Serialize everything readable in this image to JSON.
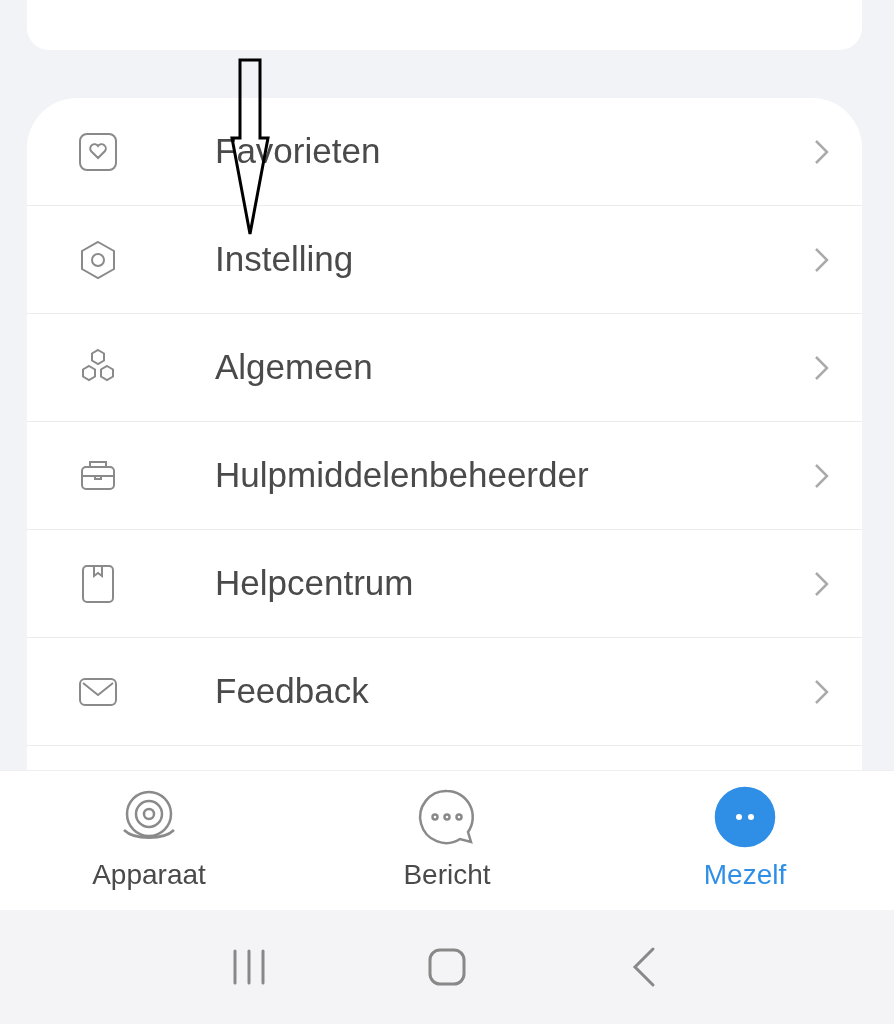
{
  "menu": [
    {
      "label": "Favorieten",
      "kind": "heart"
    },
    {
      "label": "Instelling",
      "kind": "hexagon"
    },
    {
      "label": "Algemeen",
      "kind": "cluster"
    },
    {
      "label": "Hulpmiddelenbeheerder",
      "kind": "toolbox"
    },
    {
      "label": "Helpcentrum",
      "kind": "book"
    },
    {
      "label": "Feedback",
      "kind": "mail"
    }
  ],
  "tabs": [
    {
      "label": "Apparaat",
      "kind": "device",
      "selected": false
    },
    {
      "label": "Bericht",
      "kind": "chat",
      "selected": false
    },
    {
      "label": "Mezelf",
      "kind": "me",
      "selected": true
    }
  ]
}
